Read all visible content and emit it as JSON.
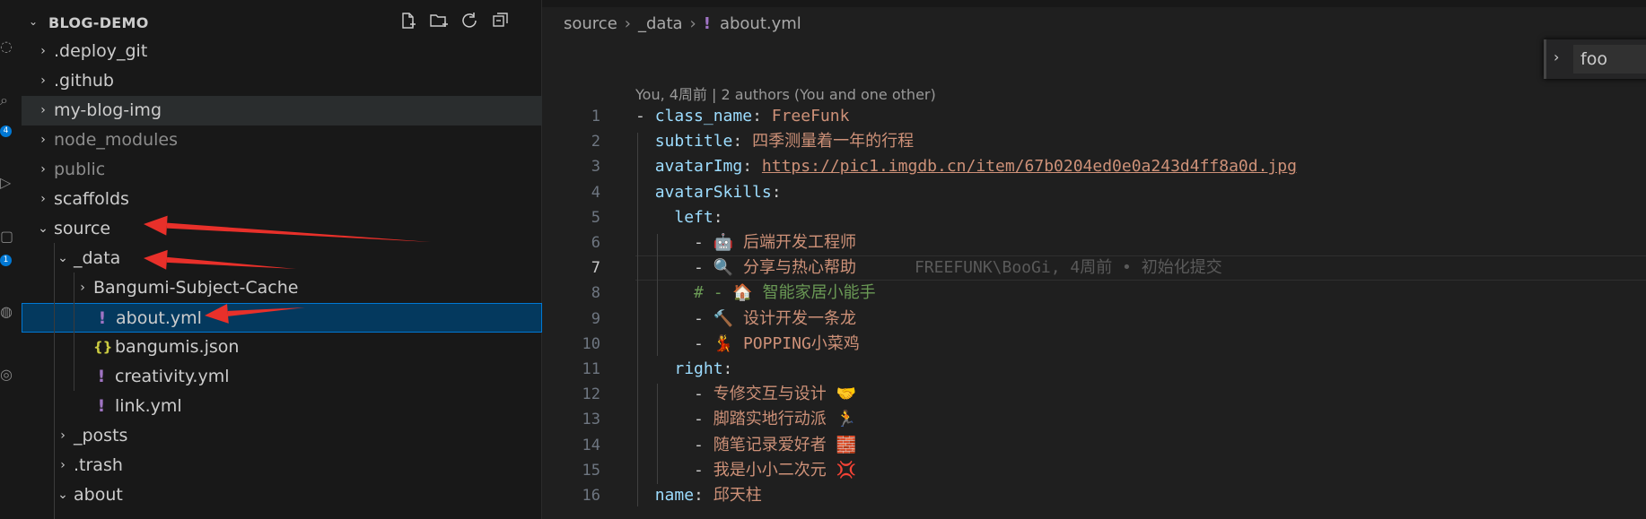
{
  "activity_bar": {
    "badge_top": "4",
    "badge_bottom": "1"
  },
  "explorer": {
    "workspace_title": "BLOG-DEMO",
    "header_actions": [
      "new-file-icon",
      "new-folder-icon",
      "refresh-icon",
      "collapse-all-icon"
    ],
    "tree": [
      {
        "label": ".deploy_git",
        "kind": "folder",
        "expanded": false,
        "depth": 0
      },
      {
        "label": ".github",
        "kind": "folder",
        "expanded": false,
        "depth": 0
      },
      {
        "label": "my-blog-img",
        "kind": "folder",
        "expanded": false,
        "depth": 0,
        "hover": true
      },
      {
        "label": "node_modules",
        "kind": "folder",
        "expanded": false,
        "depth": 0,
        "dim": true
      },
      {
        "label": "public",
        "kind": "folder",
        "expanded": false,
        "depth": 0,
        "dim": true
      },
      {
        "label": "scaffolds",
        "kind": "folder",
        "expanded": false,
        "depth": 0
      },
      {
        "label": "source",
        "kind": "folder",
        "expanded": true,
        "depth": 0
      },
      {
        "label": "_data",
        "kind": "folder",
        "expanded": true,
        "depth": 1
      },
      {
        "label": "Bangumi-Subject-Cache",
        "kind": "folder",
        "expanded": false,
        "depth": 2
      },
      {
        "label": "about.yml",
        "kind": "yaml",
        "depth": 2,
        "selected": true
      },
      {
        "label": "bangumis.json",
        "kind": "json",
        "depth": 2
      },
      {
        "label": "creativity.yml",
        "kind": "yaml",
        "depth": 2
      },
      {
        "label": "link.yml",
        "kind": "yaml",
        "depth": 2
      },
      {
        "label": "_posts",
        "kind": "folder",
        "expanded": false,
        "depth": 1
      },
      {
        "label": ".trash",
        "kind": "folder",
        "expanded": false,
        "depth": 1
      },
      {
        "label": "about",
        "kind": "folder",
        "expanded": true,
        "depth": 1
      }
    ],
    "yaml_icon": "!",
    "json_icon": "{}",
    "yaml_icon_color": "#a074c4",
    "json_icon_color": "#cbcb41"
  },
  "annotation_color": "#e8302a",
  "editor": {
    "breadcrumb": [
      "source",
      "_data",
      "about.yml"
    ],
    "breadcrumb_file_icon": "!",
    "find": {
      "value": "foo"
    },
    "codelens": "You, 4周前 | 2 authors (You and one other)",
    "active_line": 7,
    "lines": [
      {
        "n": "1",
        "tokens": [
          {
            "t": "- ",
            "c": "p"
          },
          {
            "t": "class_name",
            "c": "k"
          },
          {
            "t": ": ",
            "c": "p"
          },
          {
            "t": "FreeFunk",
            "c": "s"
          }
        ]
      },
      {
        "n": "2",
        "tokens": [
          {
            "t": "  ",
            "c": "p"
          },
          {
            "t": "subtitle",
            "c": "k"
          },
          {
            "t": ": ",
            "c": "p"
          },
          {
            "t": "四季测量着一年的行程",
            "c": "s"
          }
        ]
      },
      {
        "n": "3",
        "tokens": [
          {
            "t": "  ",
            "c": "p"
          },
          {
            "t": "avatarImg",
            "c": "k"
          },
          {
            "t": ": ",
            "c": "p"
          },
          {
            "t": "https://pic1.imgdb.cn/item/67b0204ed0e0a243d4ff8a0d.jpg",
            "c": "u"
          }
        ]
      },
      {
        "n": "4",
        "tokens": [
          {
            "t": "  ",
            "c": "p"
          },
          {
            "t": "avatarSkills",
            "c": "k"
          },
          {
            "t": ":",
            "c": "p"
          }
        ]
      },
      {
        "n": "5",
        "tokens": [
          {
            "t": "    ",
            "c": "p"
          },
          {
            "t": "left",
            "c": "k"
          },
          {
            "t": ":",
            "c": "p"
          }
        ]
      },
      {
        "n": "6",
        "tokens": [
          {
            "t": "      - ",
            "c": "p"
          },
          {
            "t": "🤖 后端开发工程师",
            "c": "s"
          }
        ]
      },
      {
        "n": "7",
        "tokens": [
          {
            "t": "      - ",
            "c": "p"
          },
          {
            "t": "🔍 分享与热心帮助",
            "c": "s"
          },
          {
            "t": "      FREEFUNK\\BooGi, 4周前 • 初始化提交",
            "c": "blame"
          }
        ]
      },
      {
        "n": "8",
        "tokens": [
          {
            "t": "      ",
            "c": "p"
          },
          {
            "t": "# - 🏠 智能家居小能手",
            "c": "c"
          }
        ]
      },
      {
        "n": "9",
        "tokens": [
          {
            "t": "      - ",
            "c": "p"
          },
          {
            "t": "🔨 设计开发一条龙",
            "c": "s"
          }
        ]
      },
      {
        "n": "10",
        "tokens": [
          {
            "t": "      - ",
            "c": "p"
          },
          {
            "t": "💃 POPPING小菜鸡",
            "c": "s"
          }
        ]
      },
      {
        "n": "11",
        "tokens": [
          {
            "t": "    ",
            "c": "p"
          },
          {
            "t": "right",
            "c": "k"
          },
          {
            "t": ":",
            "c": "p"
          }
        ]
      },
      {
        "n": "12",
        "tokens": [
          {
            "t": "      - ",
            "c": "p"
          },
          {
            "t": "专修交互与设计 🤝",
            "c": "s"
          }
        ]
      },
      {
        "n": "13",
        "tokens": [
          {
            "t": "      - ",
            "c": "p"
          },
          {
            "t": "脚踏实地行动派 🏃",
            "c": "s"
          }
        ]
      },
      {
        "n": "14",
        "tokens": [
          {
            "t": "      - ",
            "c": "p"
          },
          {
            "t": "随笔记录爱好者 🧱",
            "c": "s"
          }
        ]
      },
      {
        "n": "15",
        "tokens": [
          {
            "t": "      - ",
            "c": "p"
          },
          {
            "t": "我是小小二次元 💢",
            "c": "s"
          }
        ]
      },
      {
        "n": "16",
        "tokens": [
          {
            "t": "  ",
            "c": "p"
          },
          {
            "t": "name",
            "c": "k"
          },
          {
            "t": ": ",
            "c": "p"
          },
          {
            "t": "邱天柱",
            "c": "s"
          }
        ]
      }
    ]
  }
}
